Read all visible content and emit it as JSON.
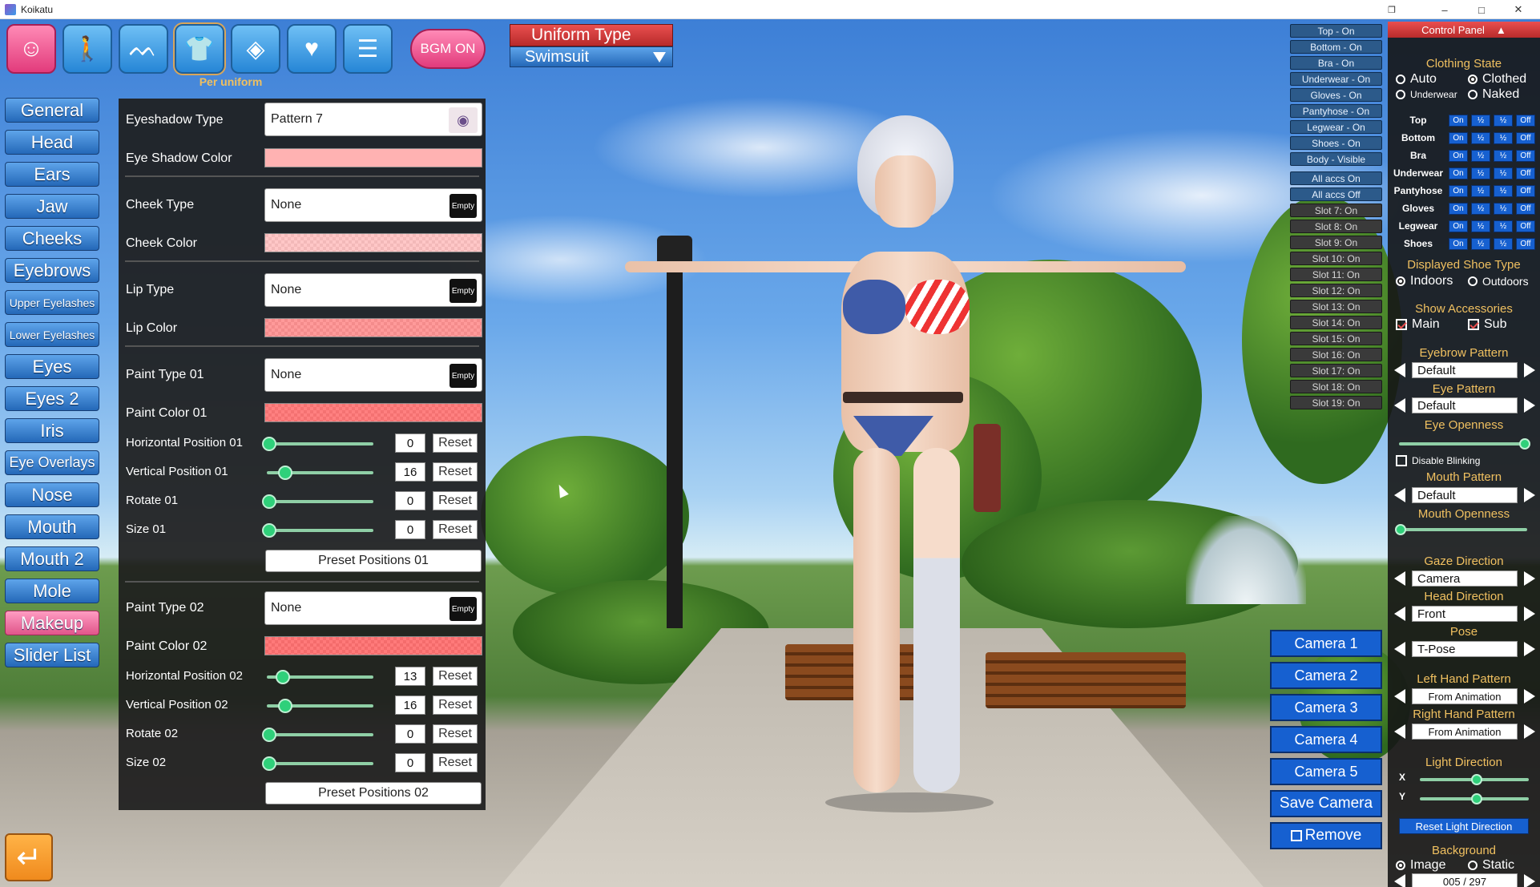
{
  "window": {
    "title": "Koikatu",
    "minimize": "–",
    "maximize": "□",
    "close": "✕"
  },
  "topbar": {
    "icons": [
      "face-icon",
      "body-icon",
      "hair-icon",
      "clothes-icon",
      "accessory-icon",
      "heart-icon",
      "document-icon"
    ],
    "per_uniform": "Per uniform",
    "bgm": "BGM ON"
  },
  "categories": [
    "General",
    "Head",
    "Ears",
    "Jaw",
    "Cheeks",
    "Eyebrows",
    "Upper Eyelashes",
    "Lower Eyelashes",
    "Eyes",
    "Eyes 2",
    "Iris",
    "Eye Overlays",
    "Nose",
    "Mouth",
    "Mouth 2",
    "Mole",
    "Makeup",
    "Slider List"
  ],
  "makeup": {
    "eyeshadow_type_label": "Eyeshadow Type",
    "eyeshadow_type": "Pattern 7",
    "eyeshadow_color_label": "Eye Shadow Color",
    "cheek_type_label": "Cheek Type",
    "cheek_type": "None",
    "cheek_color_label": "Cheek Color",
    "lip_type_label": "Lip Type",
    "lip_type": "None",
    "lip_color_label": "Lip Color",
    "paint1_type_label": "Paint Type 01",
    "paint1_type": "None",
    "paint1_color_label": "Paint Color 01",
    "paint1_sliders": [
      {
        "label": "Horizontal Position 01",
        "value": "0"
      },
      {
        "label": "Vertical Position 01",
        "value": "16"
      },
      {
        "label": "Rotate 01",
        "value": "0"
      },
      {
        "label": "Size 01",
        "value": "0"
      }
    ],
    "preset1": "Preset Positions 01",
    "paint2_type_label": "Paint Type 02",
    "paint2_type": "None",
    "paint2_color_label": "Paint Color 02",
    "paint2_sliders": [
      {
        "label": "Horizontal Position 02",
        "value": "13"
      },
      {
        "label": "Vertical Position 02",
        "value": "16"
      },
      {
        "label": "Rotate 02",
        "value": "0"
      },
      {
        "label": "Size 02",
        "value": "0"
      }
    ],
    "preset2": "Preset Positions 02",
    "empty": "Empty",
    "reset": "Reset"
  },
  "colors": {
    "eyeshadow": "#ffb2b2",
    "cheek": "#ffc7c7",
    "lip": "#ff9a9a",
    "paint1": "#ff8080",
    "paint2": "#ff7a7a",
    "accent_blue": "#1660d0",
    "accent_red": "#e94f4f",
    "accent_gold": "#f0c060"
  },
  "uniform": {
    "title": "Uniform Type",
    "value": "Swimsuit"
  },
  "toggles": [
    "Top - On",
    "Bottom - On",
    "Bra - On",
    "Underwear - On",
    "Gloves - On",
    "Pantyhose - On",
    "Legwear - On",
    "Shoes - On",
    "Body - Visible"
  ],
  "acc_toggles": [
    "All accs On",
    "All accs Off"
  ],
  "slots": [
    "Slot 7: On",
    "Slot 8: On",
    "Slot 9: On",
    "Slot 10: On",
    "Slot 11: On",
    "Slot 12: On",
    "Slot 13: On",
    "Slot 14: On",
    "Slot 15: On",
    "Slot 16: On",
    "Slot 17: On",
    "Slot 18: On",
    "Slot 19: On"
  ],
  "cameras": [
    "Camera 1",
    "Camera 2",
    "Camera 3",
    "Camera 4",
    "Camera 5",
    "Save Camera",
    "Remove"
  ],
  "control": {
    "title": "Control Panel",
    "clothing_state": "Clothing State",
    "auto": "Auto",
    "clothed": "Clothed",
    "underwear": "Underwear",
    "naked": "Naked",
    "cloth_rows": [
      "Top",
      "Bottom",
      "Bra",
      "Underwear",
      "Pantyhose",
      "Gloves",
      "Legwear",
      "Shoes"
    ],
    "cloth_btns": [
      "On",
      "½",
      "½",
      "Off"
    ],
    "shoe_type": "Displayed Shoe Type",
    "indoors": "Indoors",
    "outdoors": "Outdoors",
    "show_acc": "Show Accessories",
    "main": "Main",
    "sub": "Sub",
    "eyebrow_pattern": "Eyebrow Pattern",
    "eyebrow_value": "Default",
    "eye_pattern": "Eye Pattern",
    "eye_value": "Default",
    "eye_openness": "Eye Openness",
    "disable_blinking": "Disable Blinking",
    "mouth_pattern": "Mouth Pattern",
    "mouth_value": "Default",
    "mouth_openness": "Mouth Openness",
    "gaze": "Gaze Direction",
    "gaze_value": "Camera",
    "head_dir": "Head Direction",
    "head_value": "Front",
    "pose": "Pose",
    "pose_value": "T-Pose",
    "left_hand": "Left Hand Pattern",
    "left_value": "From Animation",
    "right_hand": "Right Hand Pattern",
    "right_value": "From Animation",
    "light_dir": "Light Direction",
    "x": "X",
    "y": "Y",
    "reset_light": "Reset Light Direction",
    "background": "Background",
    "image": "Image",
    "static": "Static",
    "bg_counter": "005 / 297"
  }
}
